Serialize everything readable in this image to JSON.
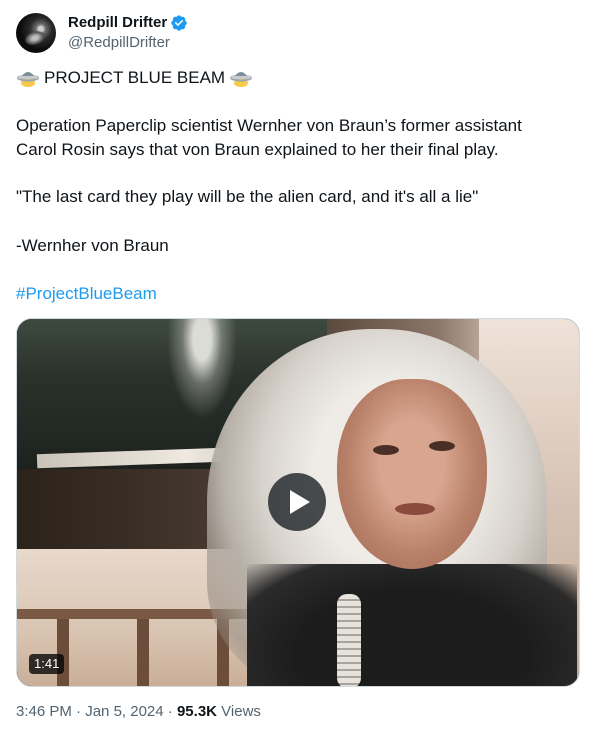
{
  "author": {
    "display_name": "Redpill Drifter",
    "handle": "@RedpillDrifter",
    "verified_color": "#1d9bf0"
  },
  "tweet": {
    "title": "PROJECT BLUE BEAM",
    "title_icon": "ufo-icon",
    "paragraph_1_line_1": "Operation Paperclip scientist Wernher von Braun’s former assistant",
    "paragraph_1_line_2": "Carol Rosin says that von Braun explained to her their final play.",
    "quote": "\"The last card they play will be the alien card, and it's all a lie\"",
    "attribution": "-Wernher von Braun",
    "hashtag": "#ProjectBlueBeam"
  },
  "media": {
    "type": "video",
    "duration": "1:41",
    "play_icon": "play-icon"
  },
  "meta": {
    "time": "3:46 PM",
    "separator": "·",
    "date": "Jan 5, 2024",
    "views_count": "95.3K",
    "views_label": "Views"
  },
  "colors": {
    "text_primary": "#0f1419",
    "text_secondary": "#536471",
    "link": "#1d9bf0"
  }
}
